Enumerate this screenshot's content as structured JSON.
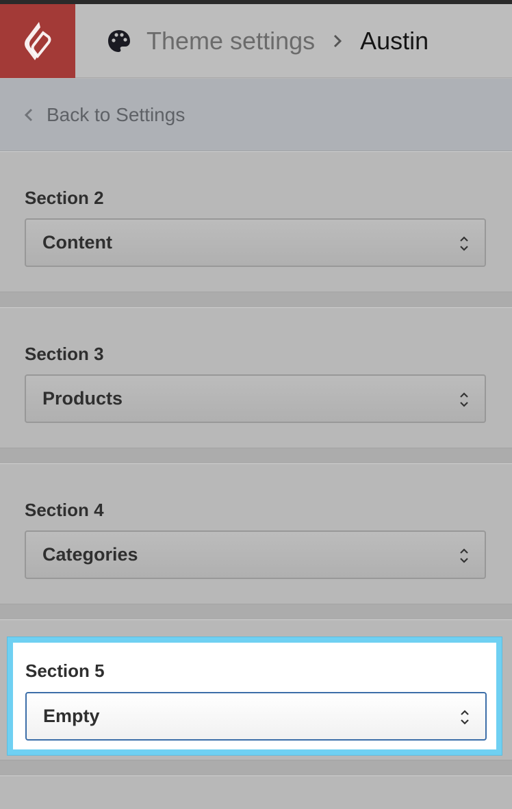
{
  "header": {
    "icon": "palette-icon",
    "crumb_link": "Theme settings",
    "crumb_current": "Austin"
  },
  "back": {
    "label": "Back to Settings"
  },
  "sections": [
    {
      "label": "Section 2",
      "value": "Content"
    },
    {
      "label": "Section 3",
      "value": "Products"
    },
    {
      "label": "Section 4",
      "value": "Categories"
    },
    {
      "label": "Section 5",
      "value": "Empty"
    }
  ],
  "colors": {
    "logo_bg": "#a33a37",
    "highlight": "#6fd0f2",
    "focus_border": "#3c6ea8"
  }
}
